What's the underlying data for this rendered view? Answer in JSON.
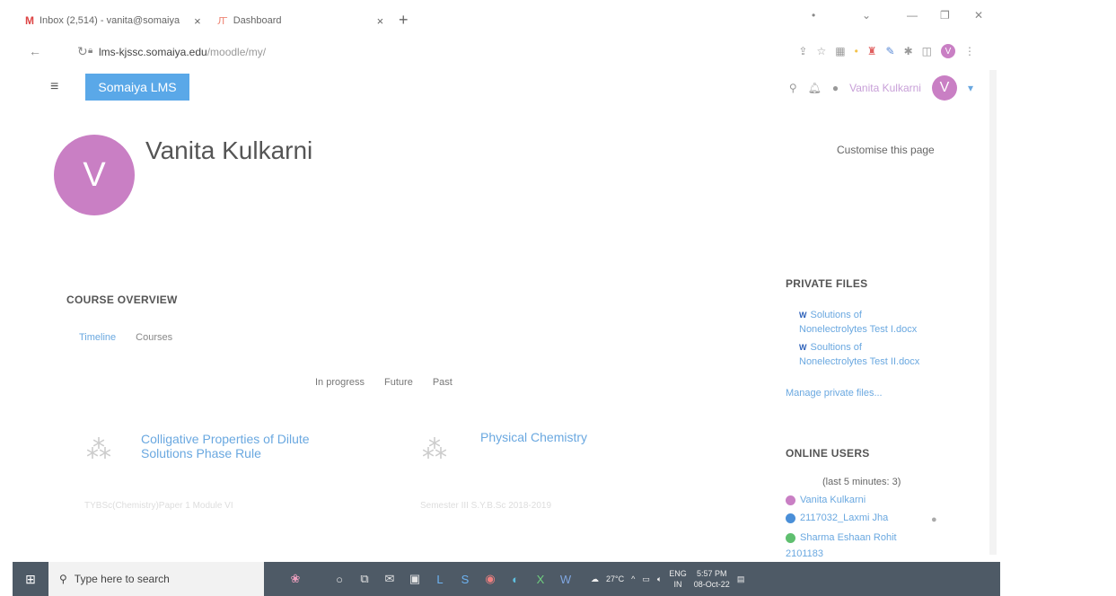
{
  "browser": {
    "tabs": [
      {
        "icon": "M",
        "label": "Inbox (2,514) - vanita@somaiya",
        "close": "×"
      },
      {
        "icon": "Ꙥ",
        "label": "Dashboard",
        "close": "×"
      }
    ],
    "new_tab": "+",
    "url_host": "lms-kjssc.somaiya.edu",
    "url_path": "/moodle/my/",
    "profile_initial": "V"
  },
  "nav": {
    "brand": "Somaiya LMS",
    "user_name": "Vanita Kulkarni",
    "user_initial": "V"
  },
  "header": {
    "avatar_initial": "V",
    "title": "Vanita Kulkarni",
    "customise": "Customise this page"
  },
  "course_overview": {
    "heading": "COURSE OVERVIEW",
    "tabs": [
      "Timeline",
      "Courses"
    ],
    "filters": [
      "In progress",
      "Future",
      "Past"
    ],
    "courses": [
      {
        "title_line1": "Colligative Properties of Dilute",
        "title_line2": "Solutions Phase Rule",
        "sub": "TYBSc(Chemistry)Paper 1 Module VI"
      },
      {
        "title_line1": "Physical Chemistry",
        "title_line2": "",
        "sub": "Semester III S.Y.B.Sc 2018-2019"
      }
    ]
  },
  "private_files": {
    "heading": "PRIVATE FILES",
    "files": [
      {
        "line1": "Solutions of",
        "line2": "Nonelectrolytes Test I.docx"
      },
      {
        "line1": "Soultions of",
        "line2": "Nonelectrolytes Test II.docx"
      }
    ],
    "manage": "Manage private files..."
  },
  "online_users": {
    "heading": "ONLINE USERS",
    "summary": "(last 5 minutes: 3)",
    "users": [
      {
        "initial": "V",
        "name": "Vanita Kulkarni",
        "color": "#c97fc4"
      },
      {
        "initial": "2",
        "name": "2117032_Laxmi Jha",
        "color": "#4a8fd8"
      },
      {
        "initial": "S",
        "name": "Sharma Eshaan Rohit",
        "color": "#5fbf6f"
      }
    ],
    "extra": "2101183"
  },
  "taskbar": {
    "search_placeholder": "Type here to search",
    "temperature": "27°C",
    "lang": "ENG",
    "region": "IN",
    "time": "5:57 PM",
    "date": "08-Oct-22"
  }
}
